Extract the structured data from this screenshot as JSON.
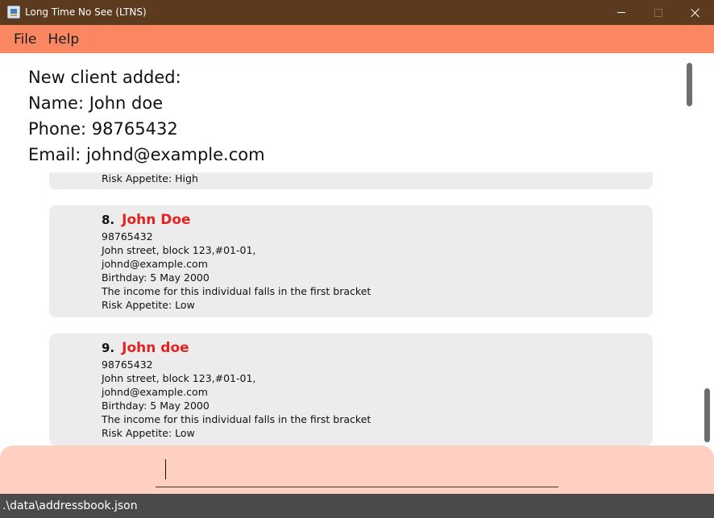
{
  "window": {
    "title": "Long Time No See (LTNS)"
  },
  "menu": {
    "items": [
      "File",
      "Help"
    ]
  },
  "result": {
    "lines": [
      "New client added:",
      "Name: John doe",
      "Phone: 98765432",
      "Email: johnd@example.com"
    ]
  },
  "client_list": {
    "partial_card": {
      "risk": "Risk Appetite: High"
    },
    "cards": [
      {
        "index": "8.",
        "name": "John Doe",
        "phone": "98765432",
        "address": "John street, block 123,#01-01,",
        "email": "johnd@example.com",
        "birthday": "Birthday: 5 May 2000",
        "income": "The income for this individual falls in the first bracket",
        "risk": "Risk Appetite: Low"
      },
      {
        "index": "9.",
        "name": "John doe",
        "phone": "98765432",
        "address": "John street, block 123,#01-01,",
        "email": "johnd@example.com",
        "birthday": "Birthday: 5 May 2000",
        "income": "The income for this individual falls in the first bracket",
        "risk": "Risk Appetite: Low"
      }
    ]
  },
  "command": {
    "value": ""
  },
  "status": {
    "path": ".\\data\\addressbook.json"
  },
  "colors": {
    "titlebar": "#5b3a1e",
    "menubar": "#fa8762",
    "card_background": "#ececec",
    "client_name": "#e52222",
    "command_box": "#ffd0c2",
    "statusbar": "#4a4a4a"
  },
  "icons": {
    "app": "app-icon",
    "minimize": "minimize-icon",
    "maximize": "maximize-icon",
    "close": "close-icon"
  }
}
